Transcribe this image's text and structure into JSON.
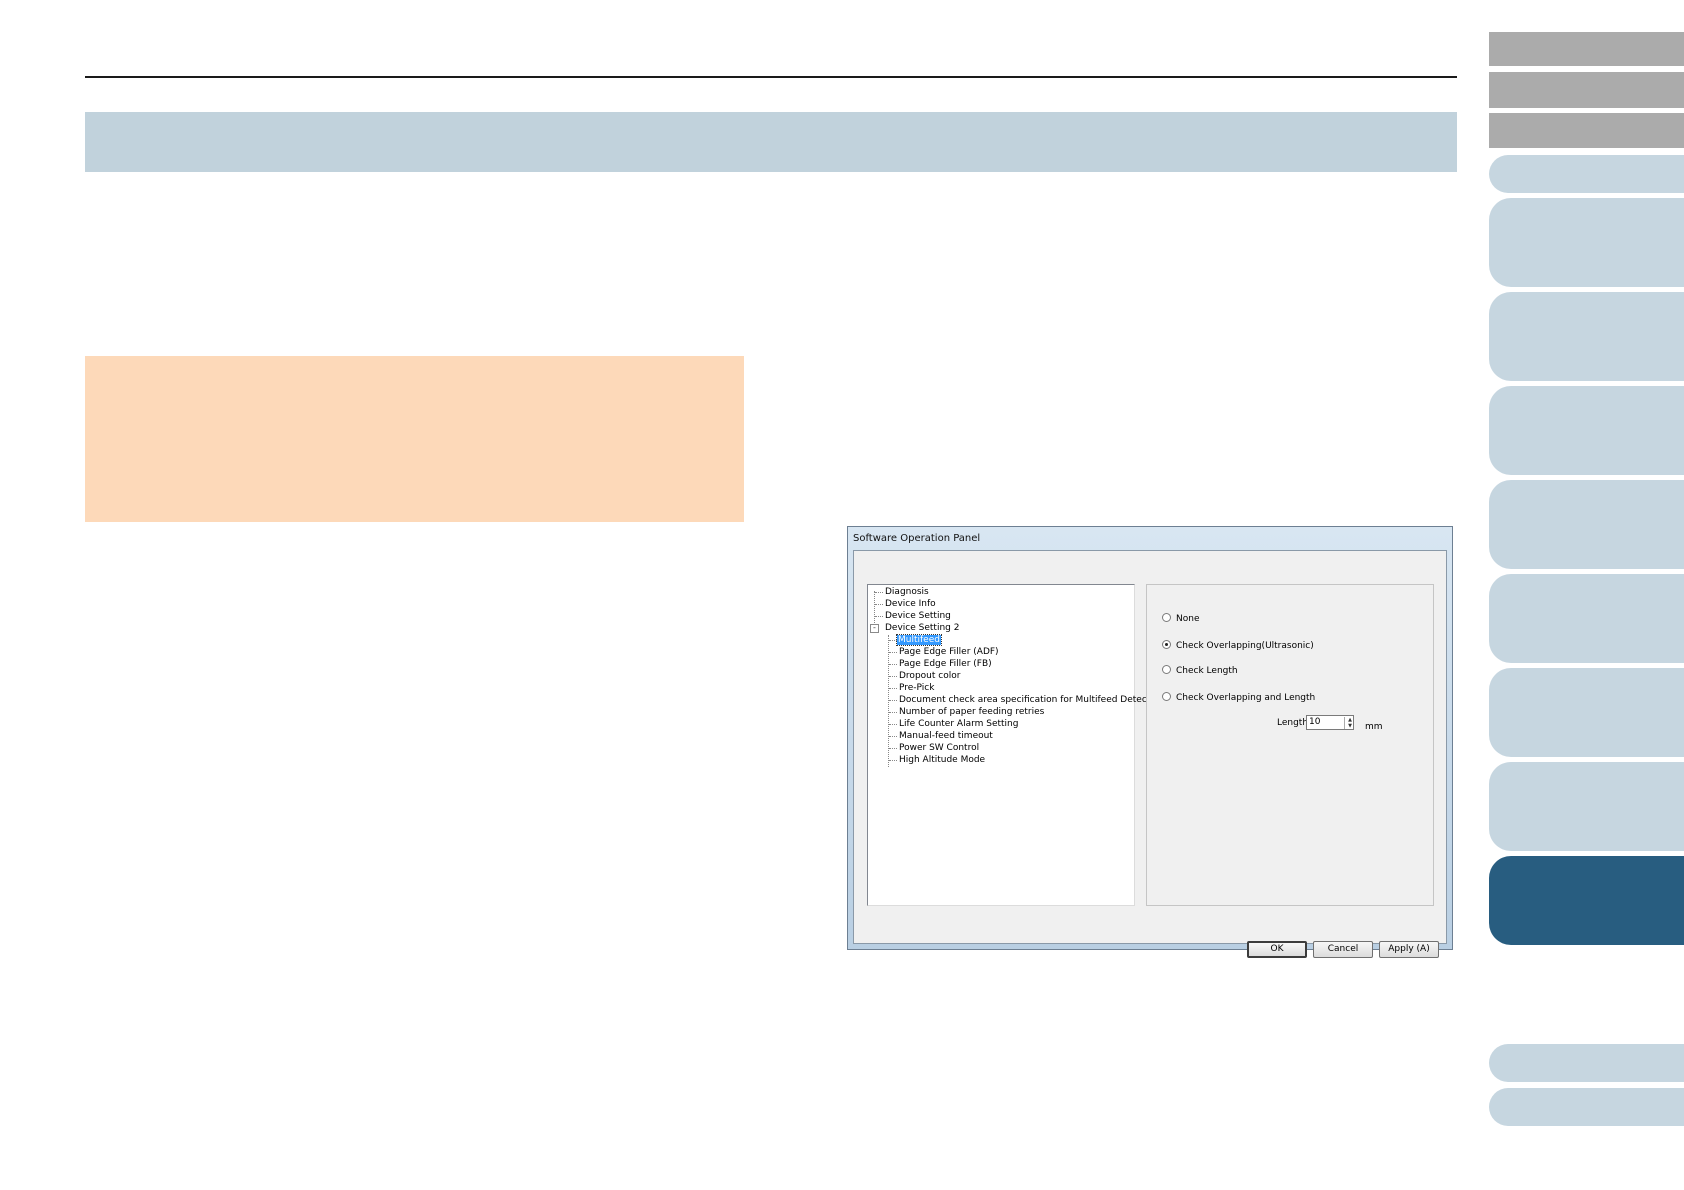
{
  "dialog": {
    "title": "Software Operation Panel",
    "tree": [
      {
        "label": "Diagnosis",
        "level": 0
      },
      {
        "label": "Device Info",
        "level": 0
      },
      {
        "label": "Device Setting",
        "level": 0
      },
      {
        "label": "Device Setting 2",
        "level": 0,
        "expander": "-"
      },
      {
        "label": "Multifeed",
        "level": 1,
        "selected": true
      },
      {
        "label": "Page Edge Filler (ADF)",
        "level": 1
      },
      {
        "label": "Page Edge Filler (FB)",
        "level": 1
      },
      {
        "label": "Dropout color",
        "level": 1
      },
      {
        "label": "Pre-Pick",
        "level": 1
      },
      {
        "label": "Document check area specification for Multifeed Detection",
        "level": 1
      },
      {
        "label": "Number of paper feeding retries",
        "level": 1
      },
      {
        "label": "Life Counter Alarm Setting",
        "level": 1
      },
      {
        "label": "Manual-feed timeout",
        "level": 1
      },
      {
        "label": "Power SW Control",
        "level": 1
      },
      {
        "label": "High Altitude Mode",
        "level": 1
      }
    ],
    "options": [
      {
        "label": "None",
        "checked": false
      },
      {
        "label": "Check Overlapping(Ultrasonic)",
        "checked": true
      },
      {
        "label": "Check Length",
        "checked": false
      },
      {
        "label": "Check Overlapping and Length",
        "checked": false
      }
    ],
    "length_label": "Length",
    "length_value": "10",
    "length_unit": "mm",
    "buttons": {
      "ok": "OK",
      "cancel": "Cancel",
      "apply": "Apply (A)"
    }
  },
  "colors": {
    "title_band": "#c1d2dc",
    "note_box": "#fdd9b9",
    "tab_gray": "#ababab",
    "tab_light": "#c6d6e0",
    "tab_active": "#285d80",
    "selection": "#3399ff"
  }
}
